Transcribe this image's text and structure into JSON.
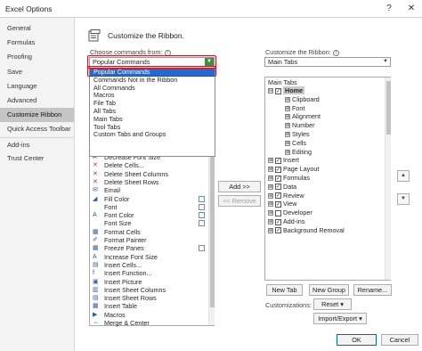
{
  "window": {
    "title": "Excel Options",
    "help_label": "?",
    "close_label": "✕"
  },
  "sidebar": {
    "items": [
      {
        "label": "General"
      },
      {
        "label": "Formulas"
      },
      {
        "label": "Proofing"
      },
      {
        "label": "Save"
      },
      {
        "label": "Language"
      },
      {
        "label": "Advanced"
      },
      {
        "label": "Customize Ribbon"
      },
      {
        "label": "Quick Access Toolbar"
      },
      {
        "label": "Add-ins"
      },
      {
        "label": "Trust Center"
      }
    ],
    "active_index": 6
  },
  "header": {
    "title": "Customize the Ribbon."
  },
  "left_panel": {
    "choose_label": "Choose commands from:",
    "info_glyph": "i",
    "selected_value": "Popular Commands",
    "dropdown_options": [
      "Popular Commands",
      "Commands Not in the Ribbon",
      "All Commands",
      "Macros",
      "File Tab",
      "All Tabs",
      "Main Tabs",
      "Tool Tabs",
      "Custom Tabs and Groups"
    ],
    "dropdown_selected_index": 0,
    "commands": [
      {
        "label": "Decrease Font Size",
        "icon": "decrease-font-icon",
        "glyph": "A"
      },
      {
        "label": "Delete Cells...",
        "icon": "delete-cells-icon",
        "glyph": "✕"
      },
      {
        "label": "Delete Sheet Columns",
        "icon": "delete-columns-icon",
        "glyph": "✕"
      },
      {
        "label": "Delete Sheet Rows",
        "icon": "delete-rows-icon",
        "glyph": "✕"
      },
      {
        "label": "Email",
        "icon": "email-icon",
        "glyph": "✉"
      },
      {
        "label": "Fill Color",
        "icon": "fill-color-icon",
        "glyph": "◢",
        "submenu": true
      },
      {
        "label": "Font",
        "icon": "font-icon",
        "glyph": "",
        "submenu": true
      },
      {
        "label": "Font Color",
        "icon": "font-color-icon",
        "glyph": "A",
        "submenu": true
      },
      {
        "label": "Font Size",
        "icon": "font-size-icon",
        "glyph": "",
        "submenu": true
      },
      {
        "label": "Format Cells",
        "icon": "format-cells-icon",
        "glyph": "▦"
      },
      {
        "label": "Format Painter",
        "icon": "format-painter-icon",
        "glyph": "✐"
      },
      {
        "label": "Freeze Panes",
        "icon": "freeze-panes-icon",
        "glyph": "▦",
        "submenu": true
      },
      {
        "label": "Increase Font Size",
        "icon": "increase-font-icon",
        "glyph": "A"
      },
      {
        "label": "Insert Cells...",
        "icon": "insert-cells-icon",
        "glyph": "▤"
      },
      {
        "label": "Insert Function...",
        "icon": "insert-function-icon",
        "glyph": "f"
      },
      {
        "label": "Insert Picture",
        "icon": "insert-picture-icon",
        "glyph": "▣"
      },
      {
        "label": "Insert Sheet Columns",
        "icon": "insert-columns-icon",
        "glyph": "▥"
      },
      {
        "label": "Insert Sheet Rows",
        "icon": "insert-rows-icon",
        "glyph": "▤"
      },
      {
        "label": "Insert Table",
        "icon": "insert-table-icon",
        "glyph": "▦"
      },
      {
        "label": "Macros",
        "icon": "macros-icon",
        "glyph": "▶"
      },
      {
        "label": "Merge & Center",
        "icon": "merge-center-icon",
        "glyph": "⇔"
      }
    ]
  },
  "middle": {
    "add_label": "Add >>",
    "remove_label": "<< Remove"
  },
  "right_panel": {
    "customize_label": "Customize the Ribbon:",
    "info_glyph": "i",
    "selected_value": "Main Tabs",
    "tree_header": "Main Tabs",
    "expand_glyph": "⊟",
    "collapse_glyph": "⊞",
    "check_glyph": "✓",
    "tree": [
      {
        "label": "Home",
        "level": 0,
        "expanded": true,
        "checked": true
      },
      {
        "label": "Clipboard",
        "level": 1
      },
      {
        "label": "Font",
        "level": 1
      },
      {
        "label": "Alignment",
        "level": 1
      },
      {
        "label": "Number",
        "level": 1
      },
      {
        "label": "Styles",
        "level": 1
      },
      {
        "label": "Cells",
        "level": 1
      },
      {
        "label": "Editing",
        "level": 1
      },
      {
        "label": "Insert",
        "level": 0,
        "checked": true
      },
      {
        "label": "Page Layout",
        "level": 0,
        "checked": true
      },
      {
        "label": "Formulas",
        "level": 0,
        "checked": true
      },
      {
        "label": "Data",
        "level": 0,
        "checked": true
      },
      {
        "label": "Review",
        "level": 0,
        "checked": true
      },
      {
        "label": "View",
        "level": 0,
        "checked": true
      },
      {
        "label": "Developer",
        "level": 0,
        "checked": false
      },
      {
        "label": "Add-ins",
        "level": 0,
        "checked": true
      },
      {
        "label": "Background Removal",
        "level": 0,
        "checked": true
      }
    ],
    "new_tab_label": "New Tab",
    "new_group_label": "New Group",
    "rename_label": "Rename...",
    "customizations_label": "Customizations:",
    "reset_label": "Reset ▾",
    "import_export_label": "Import/Export ▾",
    "move_up_glyph": "▲",
    "move_down_glyph": "▼"
  },
  "footer": {
    "ok_label": "OK",
    "cancel_label": "Cancel"
  },
  "colors": {
    "accent": "#1f6bd0",
    "highlight_border": "#d0141f",
    "nav_active": "#c5c5c5"
  }
}
